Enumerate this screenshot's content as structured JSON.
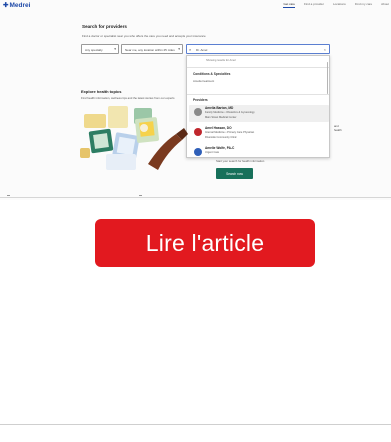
{
  "app": {
    "logo_text": "Medrei",
    "nav": [
      "Get care",
      "Find a provider",
      "Locations",
      "Find my care",
      "About"
    ]
  },
  "search": {
    "title": "Search for providers",
    "subtitle": "Find a doctor or specialist near you who offers the care you need and accepts your insurance",
    "field_specialty": "Any specialty",
    "field_location": "Near me, any location within 25 miles",
    "query_value": "Dr. Amel"
  },
  "dropdown": {
    "hint": "Showing results for Amel",
    "specialties_heading": "Conditions & Specialties",
    "specialty_item": "Amelia treatment",
    "providers_heading": "Providers",
    "providers": [
      {
        "name": "Amelia Barton, MD",
        "line1": "Family Medicine • Obstetrics & Gynecology",
        "line2": "Main Street Medical Center",
        "color": "#8a8a8a"
      },
      {
        "name": "Amel Hassan, DO",
        "line1": "Internal Medicine • Primary Care Physician",
        "line2": "Riverside Community Clinic",
        "color": "#c0272d"
      },
      {
        "name": "Amelie Wolfe, PA-C",
        "line1": "Urgent Care",
        "line2": "",
        "color": "#2f5fb8"
      }
    ]
  },
  "explore": {
    "title": "Explore health topics",
    "subtitle": "Find health information, wellness tips and the latest stories from our experts"
  },
  "right_text": [
    "and",
    "health"
  ],
  "footer_text": "Start your search for health information",
  "green_button": "Search now",
  "cta_label": "Lire l'article"
}
